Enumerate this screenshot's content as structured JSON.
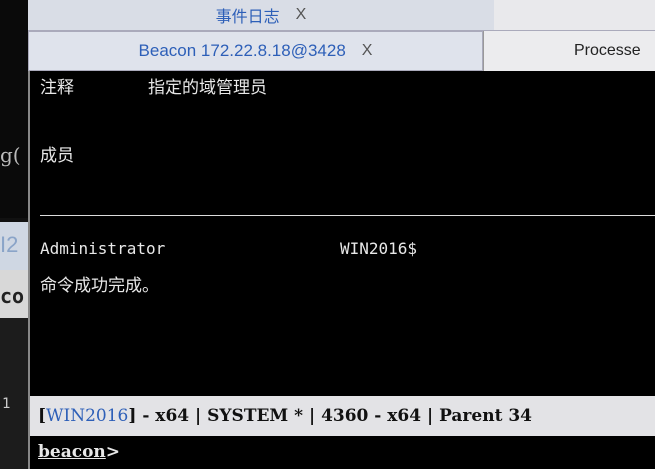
{
  "tabs_top": [
    {
      "label": "事件日志",
      "close": "X"
    }
  ],
  "tabs_second": [
    {
      "label": "Beacon 172.22.8.18@3428",
      "close": "X"
    },
    {
      "label": "Processe"
    }
  ],
  "gutter": {
    "text_top": "g(",
    "text_mid_hl": "I2",
    "text_mid": "co",
    "text_low": "1"
  },
  "console": {
    "line1_label": "注释",
    "line1_value": "指定的域管理员",
    "line2_label": "成员",
    "member_name": "Administrator",
    "member_host": "WIN2016$",
    "success": "命令成功完成。"
  },
  "status": {
    "open_bracket": "[",
    "host": "WIN2016",
    "rest": "] - x64 |  SYSTEM * | 4360 - x64 | Parent 34"
  },
  "input": {
    "prompt": "beacon",
    "prompt_suffix": ">",
    "value": ""
  }
}
